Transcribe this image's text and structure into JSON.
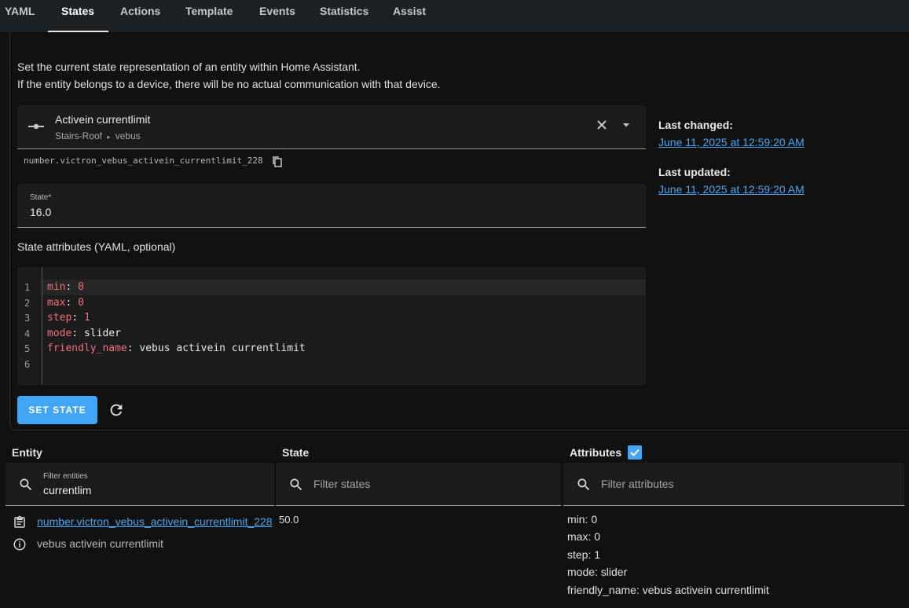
{
  "tabs": [
    {
      "label": "YAML"
    },
    {
      "label": "States"
    },
    {
      "label": "Actions"
    },
    {
      "label": "Template"
    },
    {
      "label": "Events"
    },
    {
      "label": "Statistics"
    },
    {
      "label": "Assist"
    }
  ],
  "active_tab": "States",
  "description": {
    "line1": "Set the current state representation of an entity within Home Assistant.",
    "line2": "If the entity belongs to a device, there will be no actual communication with that device."
  },
  "entity_picker": {
    "name": "Activein currentlimit",
    "area": "Stairs-Roof",
    "device": "vebus",
    "entity_id": "number.victron_vebus_activein_currentlimit_228"
  },
  "state_field": {
    "label": "State*",
    "value": "16.0"
  },
  "attributes_label": "State attributes (YAML, optional)",
  "yaml_lines": [
    {
      "num": "1",
      "key": "min",
      "value": "0",
      "numeric": true
    },
    {
      "num": "2",
      "key": "max",
      "value": "0",
      "numeric": true
    },
    {
      "num": "3",
      "key": "step",
      "value": "1",
      "numeric": true
    },
    {
      "num": "4",
      "key": "mode",
      "value": "slider",
      "numeric": false
    },
    {
      "num": "5",
      "key": "friendly_name",
      "value": "vebus activein currentlimit",
      "numeric": false
    },
    {
      "num": "6",
      "key": "",
      "value": "",
      "numeric": false
    }
  ],
  "set_state_label": "SET STATE",
  "last_changed": {
    "label": "Last changed:",
    "value": "June 11, 2025 at 12:59:20 AM"
  },
  "last_updated": {
    "label": "Last updated:",
    "value": "June 11, 2025 at 12:59:20 AM"
  },
  "table": {
    "headers": {
      "entity": "Entity",
      "state": "State",
      "attributes": "Attributes"
    },
    "attributes_checked": true,
    "filters": {
      "entity_label": "Filter entities",
      "entity_value": "currentlim",
      "state_placeholder": "Filter states",
      "attributes_placeholder": "Filter attributes"
    },
    "row": {
      "entity_id": "number.victron_vebus_activein_currentlimit_228",
      "friendly_name": "vebus activein currentlimit",
      "state": "50.0",
      "attributes": [
        "min: 0",
        "max: 0",
        "step: 1",
        "mode: slider",
        "friendly_name: vebus activein currentlimit"
      ]
    }
  },
  "colors": {
    "accent": "#42a5f5",
    "link": "#4aa6f0",
    "yaml_key": "#f07178"
  },
  "icons": [
    "entity-number-icon",
    "clear-icon",
    "chevron-down-icon",
    "copy-icon",
    "refresh-icon",
    "search-icon",
    "clipboard-icon",
    "info-icon",
    "checkmark-icon"
  ]
}
